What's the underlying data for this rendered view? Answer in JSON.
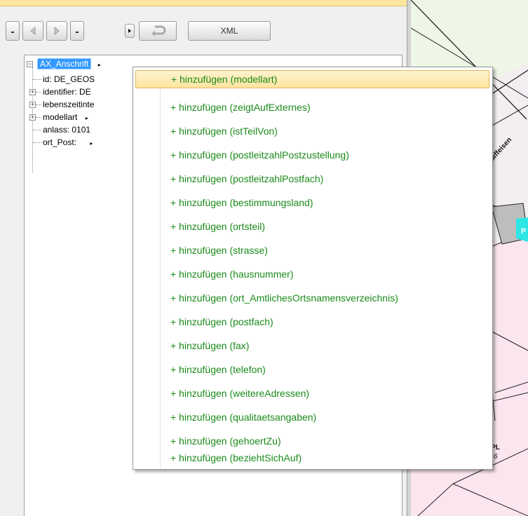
{
  "toolbar": {
    "xml_label": "XML"
  },
  "tree": {
    "root": "AX_Anschrift",
    "children": [
      "id: DE_GEOS",
      "identifier: DE",
      "lebenszeitinte",
      "modellart",
      "anlass: 0101",
      "ort_Post:"
    ]
  },
  "map": {
    "street_label": "Raiffeisen",
    "parcel_label": "BPL",
    "parcel_number": "6",
    "parcel_marker": "P"
  },
  "context_menu": {
    "items": [
      "+ hinzufügen (modellart)",
      "+ hinzufügen (zeigtAufExternes)",
      "+ hinzufügen (istTeilVon)",
      "+ hinzufügen (postleitzahlPostzustellung)",
      "+ hinzufügen (postleitzahlPostfach)",
      "+ hinzufügen (bestimmungsland)",
      "+ hinzufügen (ortsteil)",
      "+ hinzufügen (strasse)",
      "+ hinzufügen (hausnummer)",
      "+ hinzufügen (ort_AmtlichesOrtsnamensverzeichnis)",
      "+ hinzufügen (postfach)",
      "+ hinzufügen (fax)",
      "+ hinzufügen (telefon)",
      "+ hinzufügen (weitereAdressen)",
      "+ hinzufügen (qualitaetsangaben)",
      "+ hinzufügen (gehoertZu)",
      "+ hinzufügen (beziehtSichAuf)"
    ],
    "highlighted_index": 0
  },
  "colors": {
    "menu_text": "#1a8a1a",
    "selection": "#3399ff",
    "highlight": "#fde4a0"
  }
}
